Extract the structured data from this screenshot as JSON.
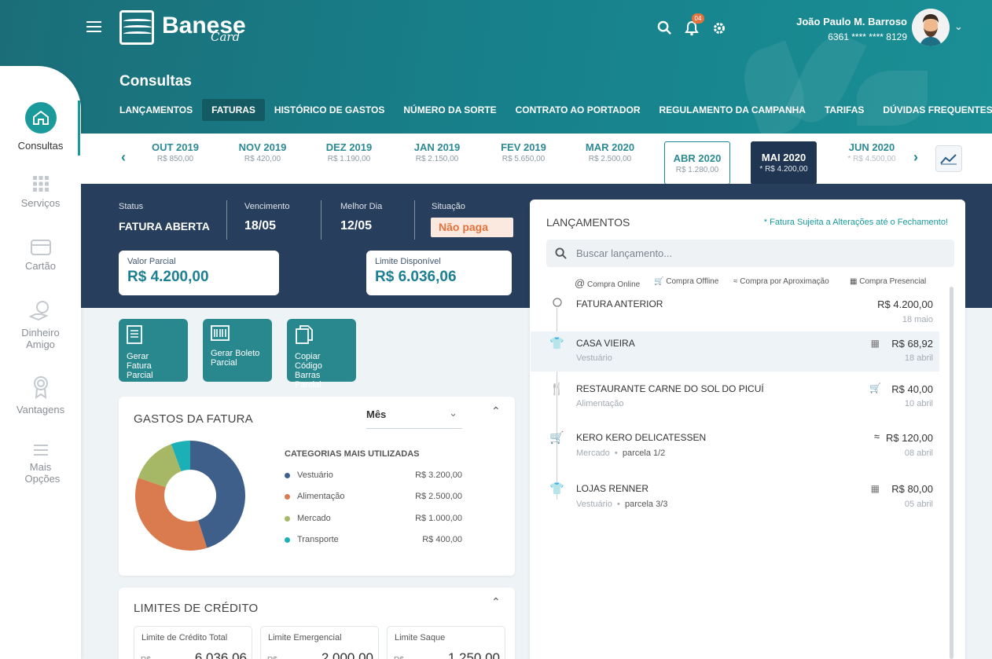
{
  "brand": {
    "name": "Banese",
    "sub": "Card"
  },
  "header": {
    "notifications": "04",
    "user_name": "João Paulo M. Barroso",
    "user_card": "6361 **** **** 8129",
    "page_title": "Consultas",
    "tabs": [
      "LANÇAMENTOS",
      "FATURAS",
      "HISTÓRICO DE GASTOS",
      "NÚMERO DA SORTE",
      "CONTRATO AO PORTADOR",
      "REGULAMENTO DA CAMPANHA",
      "TARIFAS",
      "DÚVIDAS FREQUENTES"
    ],
    "active_tab": "FATURAS"
  },
  "sidebar": {
    "items": [
      {
        "label": "Consultas",
        "icon": "home-icon",
        "active": true
      },
      {
        "label": "Serviços",
        "icon": "grid-icon"
      },
      {
        "label": "Cartão",
        "icon": "card-icon"
      },
      {
        "label": "Dinheiro Amigo",
        "icon": "money-hand-icon"
      },
      {
        "label": "Vantagens",
        "icon": "award-icon"
      },
      {
        "label": "Mais Opções",
        "icon": "menu-icon"
      }
    ]
  },
  "months": [
    {
      "name": "OUT 2019",
      "value": "R$ 850,00"
    },
    {
      "name": "NOV 2019",
      "value": "R$ 420,00"
    },
    {
      "name": "DEZ 2019",
      "value": "R$ 1.190,00"
    },
    {
      "name": "JAN 2019",
      "value": "R$ 2.150,00"
    },
    {
      "name": "FEV 2019",
      "value": "R$ 5.650,00"
    },
    {
      "name": "MAR 2020",
      "value": "R$ 2.500,00"
    },
    {
      "name": "ABR 2020",
      "value": "R$ 1.280,00"
    },
    {
      "name": "MAI 2020",
      "value": "* R$ 4.200,00"
    },
    {
      "name": "JUN 2020",
      "value": "* R$ 4.500,00"
    }
  ],
  "invoice": {
    "status_label": "Status",
    "status": "FATURA ABERTA",
    "due_label": "Vencimento",
    "due": "18/05",
    "best_label": "Melhor Dia",
    "best": "12/05",
    "situation_label": "Situação",
    "situation": "Não paga",
    "partial_label": "Valor Parcial",
    "partial": "R$ 4.200,00",
    "limit_label": "Limite Disponível",
    "limit": "R$ 6.036,06"
  },
  "actions": [
    {
      "line1": "Gerar",
      "line2": "Fatura Parcial"
    },
    {
      "line1": "Gerar Boleto",
      "line2": "Parcial"
    },
    {
      "line1": "Copiar Código",
      "line2": "Barras Parcial"
    }
  ],
  "spending": {
    "title": "GASTOS DA FATURA",
    "period": "Mês",
    "categories_title": "CATEGORIAS MAIS UTILIZADAS"
  },
  "chart_data": {
    "type": "pie",
    "categories": [
      "Vestuário",
      "Alimentação",
      "Mercado",
      "Transporte"
    ],
    "values": [
      3200,
      2500,
      1000,
      400
    ],
    "value_labels": [
      "R$ 3.200,00",
      "R$ 2.500,00",
      "R$ 1.000,00",
      "R$ 400,00"
    ],
    "colors": [
      "#3d5f8a",
      "#d97b4f",
      "#a6b866",
      "#1ab0b5"
    ],
    "donut": true
  },
  "limits": {
    "title": "LIMITES DE CRÉDITO",
    "items": [
      {
        "label": "Limite de Crédito Total",
        "value": "6.036,06"
      },
      {
        "label": "Limite Emergencial",
        "value": "2.000,00"
      },
      {
        "label": "Limite Saque",
        "value": "1.250,00"
      }
    ],
    "currency": "R$"
  },
  "lancamentos": {
    "title": "LANÇAMENTOS",
    "note": "* Fatura Sujeita a Alterações até o Fechamento!",
    "search_placeholder": "Buscar lançamento...",
    "legend": [
      "Compra Online",
      "Compra Offline",
      "Compra por Aproximação",
      "Compra Presencial"
    ],
    "items": [
      {
        "name": "FATURA ANTERIOR",
        "category": "",
        "amount": "R$ 4.200,00",
        "date": "18 maio",
        "icon": "circle-icon"
      },
      {
        "name": "CASA VIEIRA",
        "category": "Vestuário",
        "amount": "R$ 68,92",
        "date": "18 abril",
        "icon": "shirt-icon",
        "type_icon": "pos-icon"
      },
      {
        "name": "RESTAURANTE CARNE DO SOL DO PICUÍ",
        "category": "Alimentação",
        "amount": "R$ 40,00",
        "date": "10 abril",
        "icon": "cutlery-icon",
        "type_icon": "cart-icon"
      },
      {
        "name": "KERO KERO DELICATESSEN",
        "category": "Mercado",
        "installment": "parcela 1/2",
        "amount": "R$ 120,00",
        "date": "08 abril",
        "icon": "basket-icon",
        "type_icon": "wifi-icon"
      },
      {
        "name": "LOJAS RENNER",
        "category": "Vestuário",
        "installment": "parcela 3/3",
        "amount": "R$ 80,00",
        "date": "05 abril",
        "icon": "shirt-icon",
        "type_icon": "pos-icon"
      }
    ]
  }
}
